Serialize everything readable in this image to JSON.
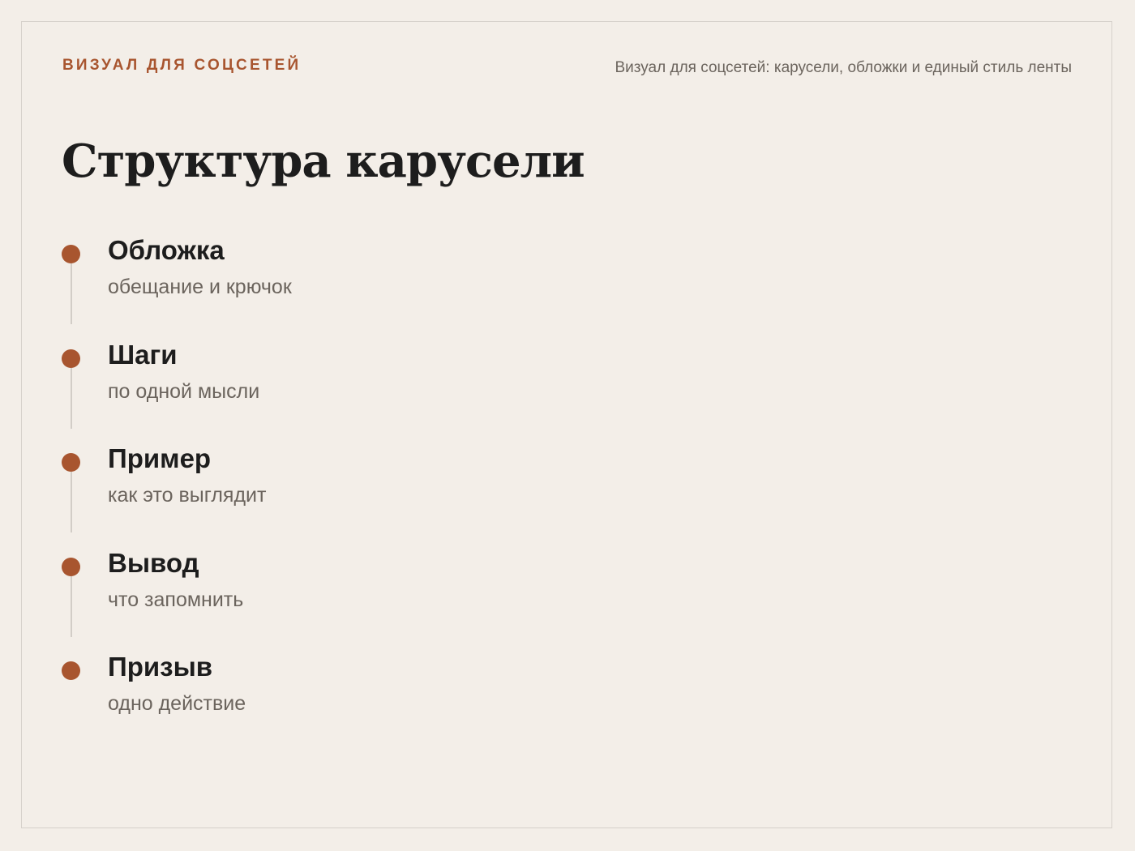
{
  "header": {
    "eyebrow": "ВИЗУАЛ ДЛЯ СОЦСЕТЕЙ",
    "topic": "Визуал для соцсетей: карусели, обложки и единый стиль ленты"
  },
  "main": {
    "title": "Структура карусели",
    "steps": [
      {
        "title": "Обложка",
        "subtitle": "обещание и крючок"
      },
      {
        "title": "Шаги",
        "subtitle": "по одной мысли"
      },
      {
        "title": "Пример",
        "subtitle": "как это выглядит"
      },
      {
        "title": "Вывод",
        "subtitle": "что запомнить"
      },
      {
        "title": "Призыв",
        "subtitle": "одно действие"
      }
    ]
  },
  "colors": {
    "accent": "#a8552f",
    "background": "#f3eee8",
    "text": "#1d1d1d",
    "muted": "#6b645d"
  }
}
